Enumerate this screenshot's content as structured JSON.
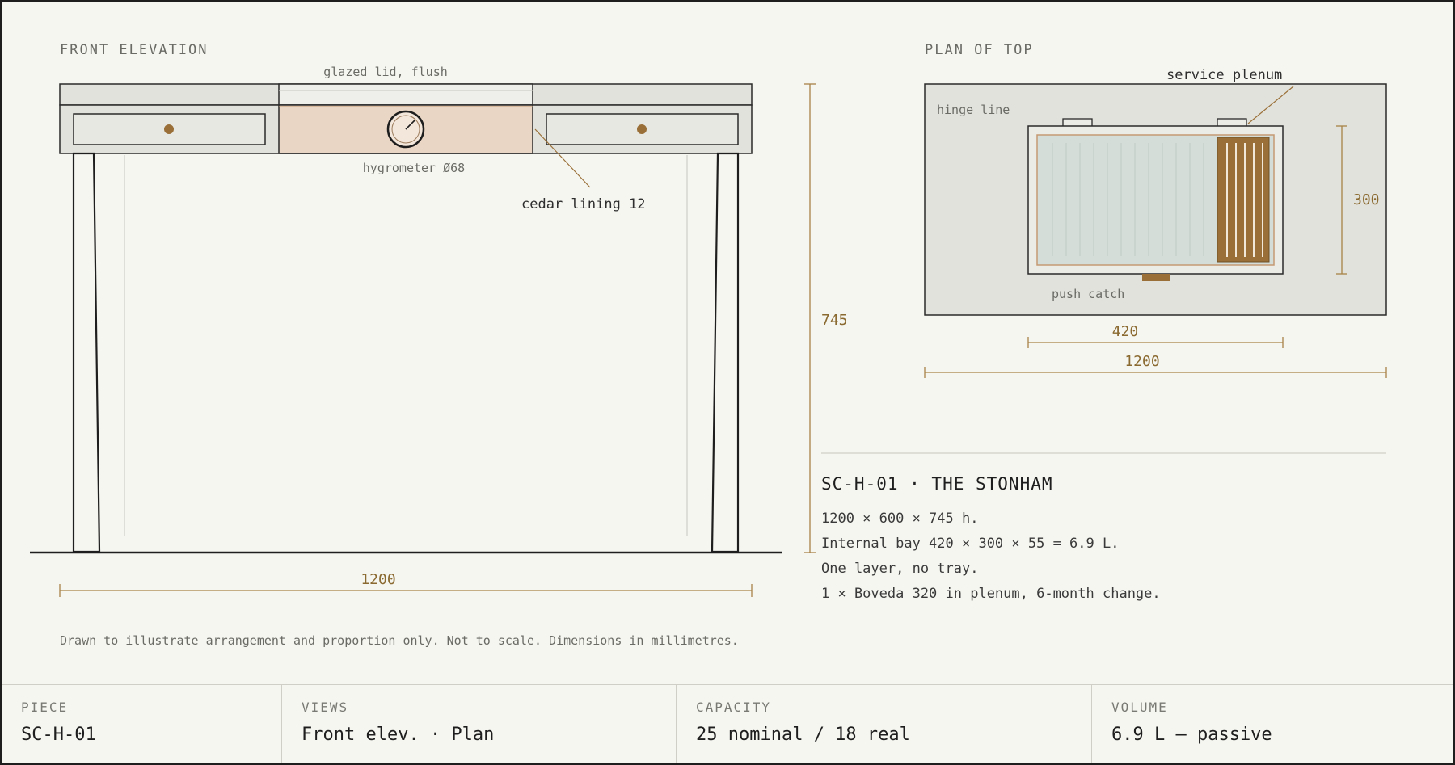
{
  "front_elevation": {
    "label": "FRONT ELEVATION",
    "lid_note": "glazed lid, flush",
    "hygrometer_note": "hygrometer Ø68",
    "cedar_note": "cedar lining 12",
    "width_dim": "1200",
    "height_dim": "745"
  },
  "plan": {
    "label": "PLAN OF TOP",
    "service_note": "service plenum",
    "hinge_note": "hinge line",
    "catch_note": "push catch",
    "depth_dim": "300",
    "bay_dim": "420",
    "width_dim": "1200"
  },
  "spec": {
    "title": "SC-H-01 · THE STONHAM",
    "lines": [
      "1200 × 600 × 745 h.",
      "Internal bay 420 × 300 × 55 = 6.9 L.",
      "One layer, no tray.",
      "1 × Boveda 320 in plenum, 6-month change."
    ]
  },
  "disclaimer": "Drawn to illustrate arrangement and proportion only. Not to scale. Dimensions in millimetres.",
  "footer": [
    {
      "label": "PIECE",
      "value": "SC-H-01"
    },
    {
      "label": "VIEWS",
      "value": "Front elev. · Plan"
    },
    {
      "label": "CAPACITY",
      "value": "25 nominal / 18 real"
    },
    {
      "label": "VOLUME",
      "value": "6.9 L — passive"
    }
  ],
  "colors": {
    "line": "#1e1e1e",
    "dimension": "#a88246",
    "cedar": "#9a7038",
    "cedar_fill": "#ead6c4",
    "glass": "#d4ddd8",
    "panel": "#e2e2dc",
    "paper": "#f6f6f1"
  }
}
